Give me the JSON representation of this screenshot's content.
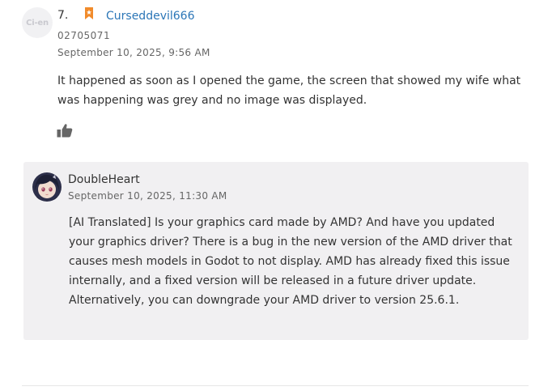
{
  "comment": {
    "avatar_text": "Ci-en",
    "number": "7.",
    "badge_icon": "bookmark-icon",
    "username": "Curseddevil666",
    "user_id": "02705071",
    "date": "September 10, 2025, 9:56 AM",
    "body": "It happened as soon as I opened the game, the screen that showed my wife what was happening was grey and no image was displayed.",
    "like_icon": "thumbs-up-icon"
  },
  "reply": {
    "author": "DoubleHeart",
    "date": "September 10, 2025, 11:30 AM",
    "body": "[AI Translated] Is your graphics card made by AMD? And have you updated your graphics driver? There is a bug in the new version of the AMD driver that causes mesh models in Godot to not display. AMD has already fixed this issue internally, and a fixed version will be released in a future driver update. Alternatively, you can downgrade your AMD driver to version 25.6.1."
  },
  "colors": {
    "link": "#2b76b7",
    "badge": "#f18b2b",
    "reply_bg": "#f1f0f2"
  }
}
